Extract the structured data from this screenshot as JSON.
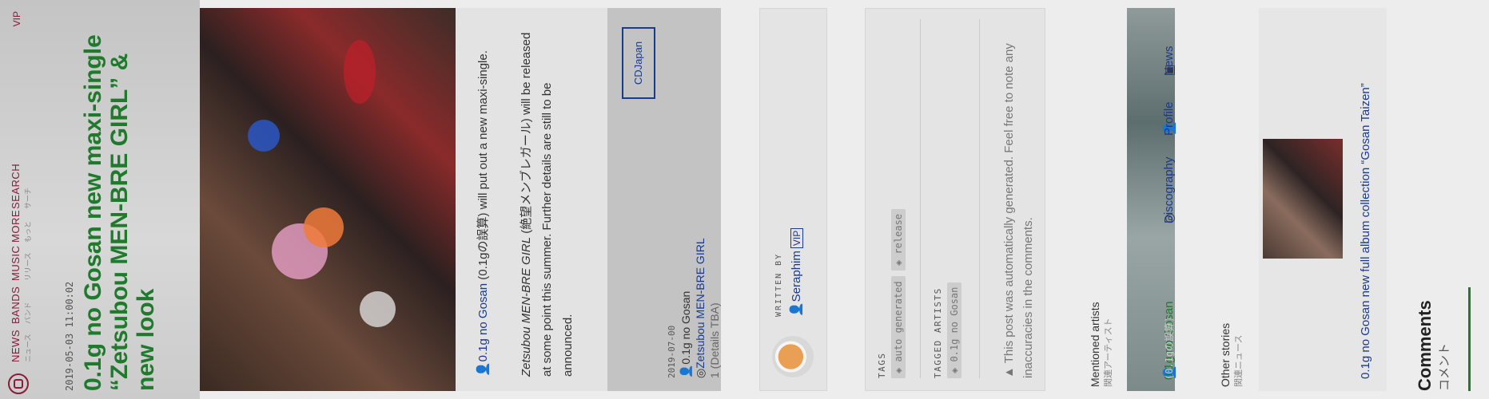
{
  "nav": {
    "vip": "VIP",
    "items": [
      {
        "en": "NEWS",
        "jp": "ニュース"
      },
      {
        "en": "BANDS",
        "jp": "バンド"
      },
      {
        "en": "MUSIC",
        "jp": "リリース"
      },
      {
        "en": "MORE",
        "jp": "もっと"
      },
      {
        "en": "SEARCH",
        "jp": "サーチ"
      }
    ]
  },
  "article": {
    "date": "2019-05-03 11:00:02",
    "title": "0.1g no Gosan new maxi-single “Zetsubou MEN-BRE GIRL” & new look",
    "p1_link": "0.1g no Gosan",
    "p1_jp": " (0.1gの誤算)",
    "p1_rest": " will put out a new maxi-single.",
    "p2_title": "Zetsubou MEN-BRE GIRL",
    "p2_rest": " (絶望メンブレガール) will be released at some point this summer. Further details are still to be announced."
  },
  "release": {
    "cdjapan": "CDJapan",
    "date": "2019-07-00",
    "artist": "0.1g no Gosan",
    "title": "Zetsubou MEN-BRE GIRL",
    "detail": "1 (Details TBA)"
  },
  "author": {
    "written_by": "WRITTEN BY",
    "name": "Seraphim",
    "vip": "VIP"
  },
  "tags": {
    "tags_label": "TAGS",
    "tags": [
      "auto generated",
      "release"
    ],
    "artists_label": "TAGGED ARTISTS",
    "artists": [
      "0.1g no Gosan"
    ],
    "note": "This post was automatically generated. Feel free to note any inaccuracies in the comments."
  },
  "mentioned": {
    "label": "Mentioned artists",
    "label_jp": "関連アーティスト",
    "artist": "0.1g no Gosan",
    "artist_jp": "(0.1gの誤算)",
    "links": [
      "Discography",
      "Profile",
      "News"
    ]
  },
  "other": {
    "label": "Other stories",
    "label_jp": "関連ニュース",
    "story_title": "0.1g no Gosan new full album collection “Gosan Taizen”"
  },
  "comments": {
    "label": "Comments",
    "label_jp": "コメント"
  }
}
